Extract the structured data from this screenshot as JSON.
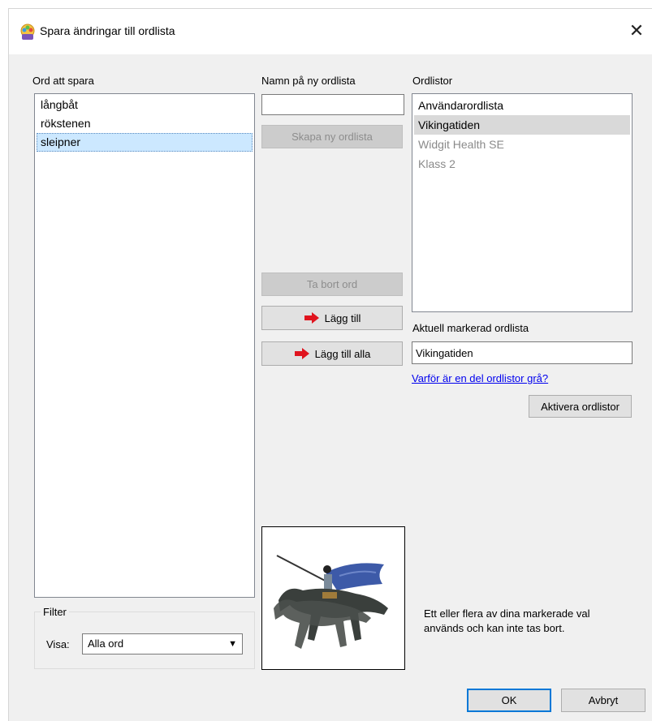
{
  "window": {
    "title": "Spara ändringar till ordlista",
    "close_glyph": "✕"
  },
  "words": {
    "label": "Ord att spara",
    "items": [
      "långbåt",
      "rökstenen",
      "sleipner"
    ],
    "selected_index": 2
  },
  "new_dictionary": {
    "label": "Namn på ny ordlista",
    "value": "",
    "create_button": "Skapa ny ordlista"
  },
  "actions": {
    "remove_word": "Ta bort ord",
    "add": "Lägg till",
    "add_all": "Lägg till alla",
    "arrow_color": "#e0141e"
  },
  "dictionaries": {
    "label": "Ordlistor",
    "items": [
      {
        "name": "Användarordlista",
        "state": "normal"
      },
      {
        "name": "Vikingatiden",
        "state": "selected"
      },
      {
        "name": "Widgit Health SE",
        "state": "grey"
      },
      {
        "name": "Klass 2",
        "state": "grey"
      }
    ]
  },
  "current": {
    "label": "Aktuell markerad ordlista",
    "value": "Vikingatiden"
  },
  "help_link": "Varför är en del ordlistor grå?",
  "activate_button": "Aktivera ordlistor",
  "filter": {
    "group_label": "Filter",
    "show_label": "Visa:",
    "selected": "Alla ord"
  },
  "symbol_image": "viking-rider-on-horse-icon",
  "info_message_line1": "Ett eller flera av dina markerade val",
  "info_message_line2": "används och kan inte tas bort.",
  "footer": {
    "ok": "OK",
    "cancel": "Avbryt"
  }
}
